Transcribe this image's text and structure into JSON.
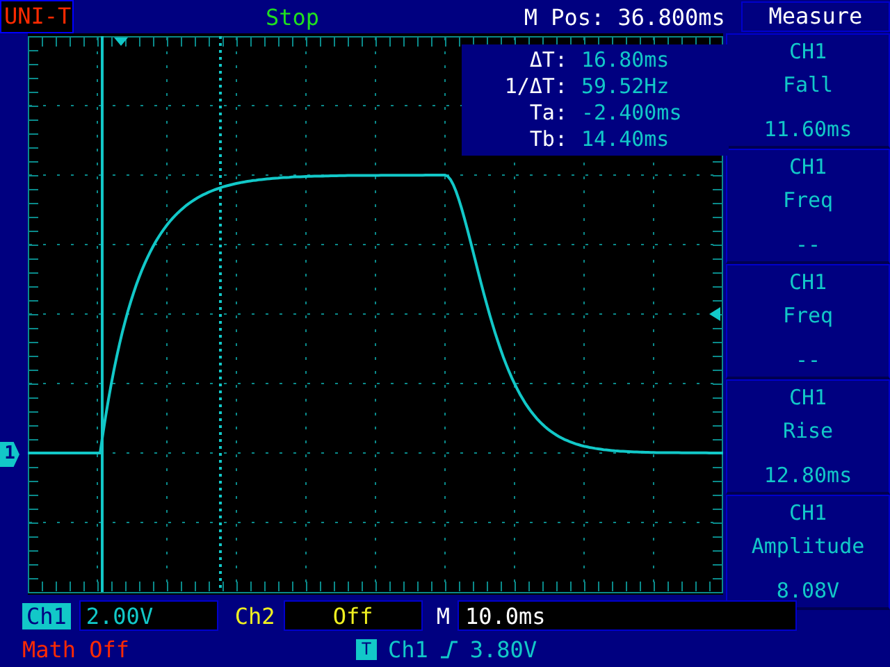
{
  "header": {
    "logo": "UNI-T",
    "status": "Stop",
    "position": "M Pos: 36.800ms",
    "menu_title": "Measure"
  },
  "cursor_readout": [
    {
      "label": "ΔT:",
      "value": "16.80ms"
    },
    {
      "label": "1/ΔT:",
      "value": "59.52Hz"
    },
    {
      "label": "Ta:",
      "value": "-2.400ms"
    },
    {
      "label": "Tb:",
      "value": "14.40ms"
    }
  ],
  "channel_marker": "1",
  "measure_items": [
    {
      "channel": "CH1",
      "name": "Fall",
      "value": "11.60ms"
    },
    {
      "channel": "CH1",
      "name": "Freq",
      "value": "--"
    },
    {
      "channel": "CH1",
      "name": "Freq",
      "value": "--"
    },
    {
      "channel": "CH1",
      "name": "Rise",
      "value": "12.80ms"
    },
    {
      "channel": "CH1",
      "name": "Amplitude",
      "value": "8.08V"
    }
  ],
  "bottom": {
    "ch1_label": "Ch1",
    "ch1_scale": "2.00V",
    "ch2_label": "Ch2",
    "ch2_state": "Off",
    "time_label": "M",
    "time_scale": "10.0ms",
    "math": "Math Off",
    "trigger_icon": "T",
    "trigger_source": "Ch1",
    "trigger_level": "3.80V"
  }
}
